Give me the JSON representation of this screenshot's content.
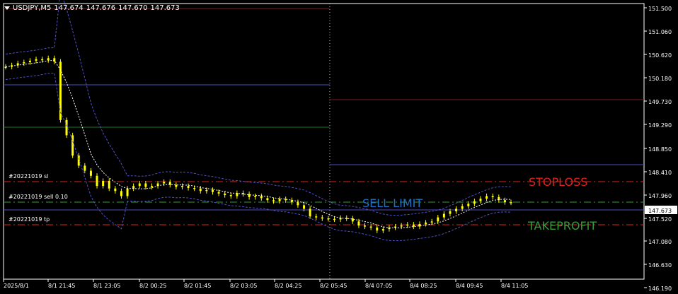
{
  "header": {
    "symbol": "USDJPY,M5",
    "open": "147.674",
    "high": "147.676",
    "low": "147.670",
    "close": "147.673"
  },
  "colors": {
    "background": "#000000",
    "candle": "#ffff00",
    "bands": "#5050c8",
    "ma": "#ffffff",
    "stoploss": "#e0201e",
    "takeprofit": "#3a9a3a",
    "sell_limit": "#1f6fc2",
    "blue_level": "#4d4dc0",
    "green_level": "#1f7a1f",
    "red_level": "#7a1f1f",
    "grid_text": "#ffffff",
    "current_price_box": "#ffffff"
  },
  "chart_data": {
    "type": "candlestick",
    "symbol": "USDJPY",
    "timeframe": "M5",
    "y_axis": {
      "min": 146.19,
      "max": 151.5,
      "ticks": [
        "151.500",
        "151.060",
        "150.620",
        "150.180",
        "149.730",
        "149.290",
        "148.850",
        "148.410",
        "147.960",
        "147.520",
        "147.080",
        "146.630",
        "146.190"
      ]
    },
    "x_axis": {
      "ticks": [
        "2025/8/1",
        "8/1 21:45",
        "8/1 23:05",
        "8/2 00:25",
        "8/2 01:45",
        "8/2 03:05",
        "8/2 04:25",
        "8/2 05:45",
        "8/4 07:05",
        "8/4 08:25",
        "8/4 09:45",
        "8/4 11:05"
      ]
    },
    "current_price": "147.673",
    "horizontal_lines": [
      {
        "label": "#20221019 sl",
        "price": 148.11,
        "color": "#e0201e",
        "style": "dashdot"
      },
      {
        "label": "#20221019 sell 0.10",
        "price": 147.76,
        "color": "#3a9a3a",
        "style": "dashdot"
      },
      {
        "label": "#20221019 tp",
        "price": 147.4,
        "color": "#e0201e",
        "style": "dashdot"
      }
    ],
    "annotations": [
      {
        "text": "STOPLOSS",
        "color": "#e0201e"
      },
      {
        "text": "SELL LIMIT",
        "color": "#1f6fc2"
      },
      {
        "text": "TAKEPROFIT",
        "color": "#3a9a3a"
      }
    ],
    "series_close": [
      150.35,
      150.38,
      150.42,
      150.44,
      150.47,
      150.5,
      150.48,
      150.52,
      150.45,
      149.3,
      149.0,
      148.6,
      148.4,
      148.3,
      148.2,
      148.0,
      148.1,
      147.95,
      147.9,
      147.8,
      147.95,
      148.0,
      148.05,
      147.98,
      148.0,
      148.05,
      148.08,
      148.02,
      147.98,
      148.0,
      147.96,
      147.95,
      147.9,
      147.92,
      147.88,
      147.85,
      147.82,
      147.8,
      147.86,
      147.84,
      147.78,
      147.8,
      147.76,
      147.72,
      147.7,
      147.74,
      147.72,
      147.68,
      147.62,
      147.55,
      147.4,
      147.38,
      147.36,
      147.35,
      147.34,
      147.37,
      147.36,
      147.3,
      147.22,
      147.2,
      147.18,
      147.12,
      147.15,
      147.18,
      147.2,
      147.22,
      147.24,
      147.2,
      147.25,
      147.28,
      147.3,
      147.38,
      147.45,
      147.5,
      147.55,
      147.6,
      147.65,
      147.7,
      147.75,
      147.8,
      147.78,
      147.72,
      147.68,
      147.673
    ]
  }
}
